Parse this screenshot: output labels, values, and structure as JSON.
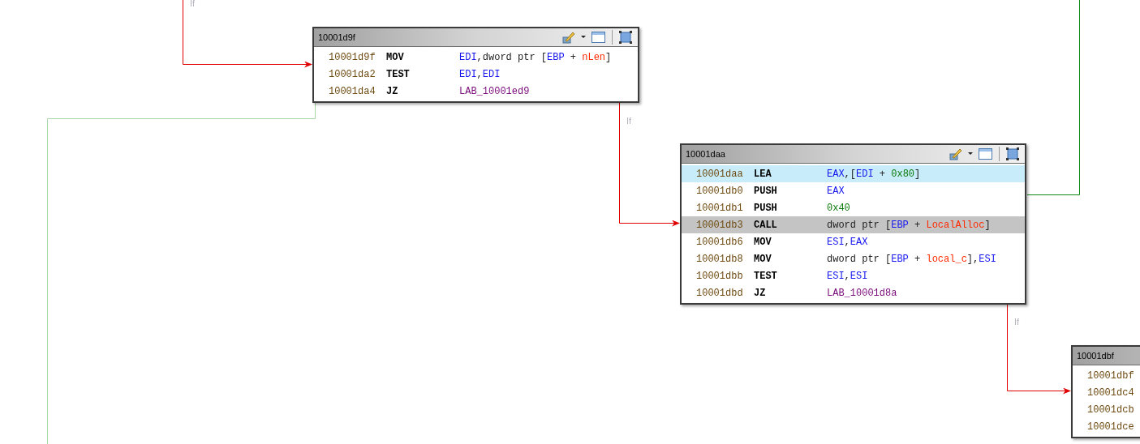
{
  "edges": [
    {
      "kind": "fallthrough",
      "label": "If"
    },
    {
      "kind": "faded"
    },
    {
      "kind": "fallthrough",
      "label": "If"
    },
    {
      "kind": "conditional"
    },
    {
      "kind": "fallthrough",
      "label": "If"
    }
  ],
  "blocks": [
    {
      "title": "10001d9f",
      "tools": true,
      "rows": [
        {
          "address": "10001d9f",
          "mnemonic": "MOV",
          "operands": [
            {
              "kind": "register",
              "text": "EDI"
            },
            {
              "kind": "plain",
              "text": ",dword ptr ["
            },
            {
              "kind": "register",
              "text": "EBP"
            },
            {
              "kind": "plain",
              "text": " + "
            },
            {
              "kind": "variable",
              "text": "nLen"
            },
            {
              "kind": "plain",
              "text": "]"
            }
          ],
          "cursor": false,
          "selected": false
        },
        {
          "address": "10001da2",
          "mnemonic": "TEST",
          "operands": [
            {
              "kind": "register",
              "text": "EDI"
            },
            {
              "kind": "plain",
              "text": ","
            },
            {
              "kind": "register",
              "text": "EDI"
            }
          ],
          "cursor": false,
          "selected": false
        },
        {
          "address": "10001da4",
          "mnemonic": "JZ",
          "operands": [
            {
              "kind": "label",
              "text": "LAB_10001ed9"
            }
          ],
          "cursor": false,
          "selected": false
        }
      ]
    },
    {
      "title": "10001daa",
      "tools": true,
      "rows": [
        {
          "address": "10001daa",
          "mnemonic": "LEA",
          "operands": [
            {
              "kind": "register",
              "text": "EAX"
            },
            {
              "kind": "plain",
              "text": ",["
            },
            {
              "kind": "register",
              "text": "EDI"
            },
            {
              "kind": "plain",
              "text": " + "
            },
            {
              "kind": "constant",
              "text": "0x80"
            },
            {
              "kind": "plain",
              "text": "]"
            }
          ],
          "cursor": true,
          "selected": false
        },
        {
          "address": "10001db0",
          "mnemonic": "PUSH",
          "operands": [
            {
              "kind": "register",
              "text": "EAX"
            }
          ],
          "cursor": false,
          "selected": false
        },
        {
          "address": "10001db1",
          "mnemonic": "PUSH",
          "operands": [
            {
              "kind": "constant",
              "text": "0x40"
            }
          ],
          "cursor": false,
          "selected": false
        },
        {
          "address": "10001db3",
          "mnemonic": "CALL",
          "operands": [
            {
              "kind": "plain",
              "text": "dword ptr ["
            },
            {
              "kind": "register",
              "text": "EBP"
            },
            {
              "kind": "plain",
              "text": " + "
            },
            {
              "kind": "variable",
              "text": "LocalAlloc"
            },
            {
              "kind": "plain",
              "text": "]"
            }
          ],
          "cursor": false,
          "selected": true
        },
        {
          "address": "10001db6",
          "mnemonic": "MOV",
          "operands": [
            {
              "kind": "register",
              "text": "ESI"
            },
            {
              "kind": "plain",
              "text": ","
            },
            {
              "kind": "register",
              "text": "EAX"
            }
          ],
          "cursor": false,
          "selected": false
        },
        {
          "address": "10001db8",
          "mnemonic": "MOV",
          "operands": [
            {
              "kind": "plain",
              "text": "dword ptr ["
            },
            {
              "kind": "register",
              "text": "EBP"
            },
            {
              "kind": "plain",
              "text": " + "
            },
            {
              "kind": "variable",
              "text": "local_c"
            },
            {
              "kind": "plain",
              "text": "],"
            },
            {
              "kind": "register",
              "text": "ESI"
            }
          ],
          "cursor": false,
          "selected": false
        },
        {
          "address": "10001dbb",
          "mnemonic": "TEST",
          "operands": [
            {
              "kind": "register",
              "text": "ESI"
            },
            {
              "kind": "plain",
              "text": ","
            },
            {
              "kind": "register",
              "text": "ESI"
            }
          ],
          "cursor": false,
          "selected": false
        },
        {
          "address": "10001dbd",
          "mnemonic": "JZ",
          "operands": [
            {
              "kind": "label",
              "text": "LAB_10001d8a"
            }
          ],
          "cursor": false,
          "selected": false
        }
      ]
    },
    {
      "title": "10001dbf",
      "rows": [
        {
          "address": "10001dbf",
          "cursor": false,
          "selected": false
        },
        {
          "address": "10001dc4",
          "cursor": false,
          "selected": false
        },
        {
          "address": "10001dcb",
          "cursor": false,
          "selected": false
        },
        {
          "address": "10001dce",
          "cursor": false,
          "selected": false
        }
      ]
    }
  ]
}
